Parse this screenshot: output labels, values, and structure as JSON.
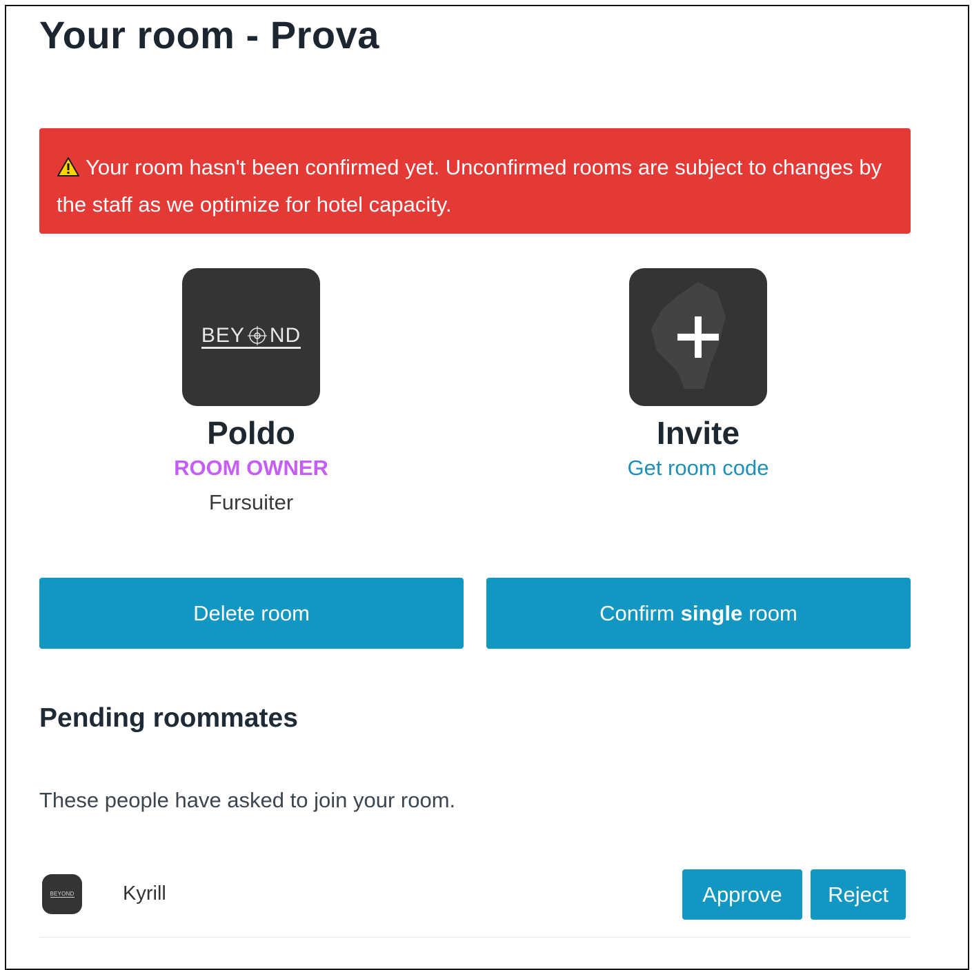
{
  "page": {
    "title": "Your room - Prova"
  },
  "alert": {
    "icon": "warning-icon",
    "text": "Your room hasn't been confirmed yet. Unconfirmed rooms are subject to changes by the staff as we optimize for hotel capacity.",
    "color": "#e53935"
  },
  "owner": {
    "avatar_logo_left": "BEY",
    "avatar_logo_right": "ND",
    "name": "Poldo",
    "role": "ROOM OWNER",
    "type": "Fursuiter"
  },
  "invite": {
    "icon": "plus-icon",
    "name": "Invite",
    "link": "Get room code"
  },
  "actions": {
    "delete_label": "Delete room",
    "confirm_prefix": "Confirm",
    "confirm_bold": "single",
    "confirm_suffix": "room"
  },
  "pending": {
    "title": "Pending roommates",
    "description": "These people have asked to join your room.",
    "items": [
      {
        "avatar_logo": "BEYOND",
        "name": "Kyrill",
        "approve_label": "Approve",
        "reject_label": "Reject"
      }
    ]
  },
  "colors": {
    "accent": "#1296c2",
    "role": "#c45ef5",
    "link": "#1e8fb8"
  }
}
